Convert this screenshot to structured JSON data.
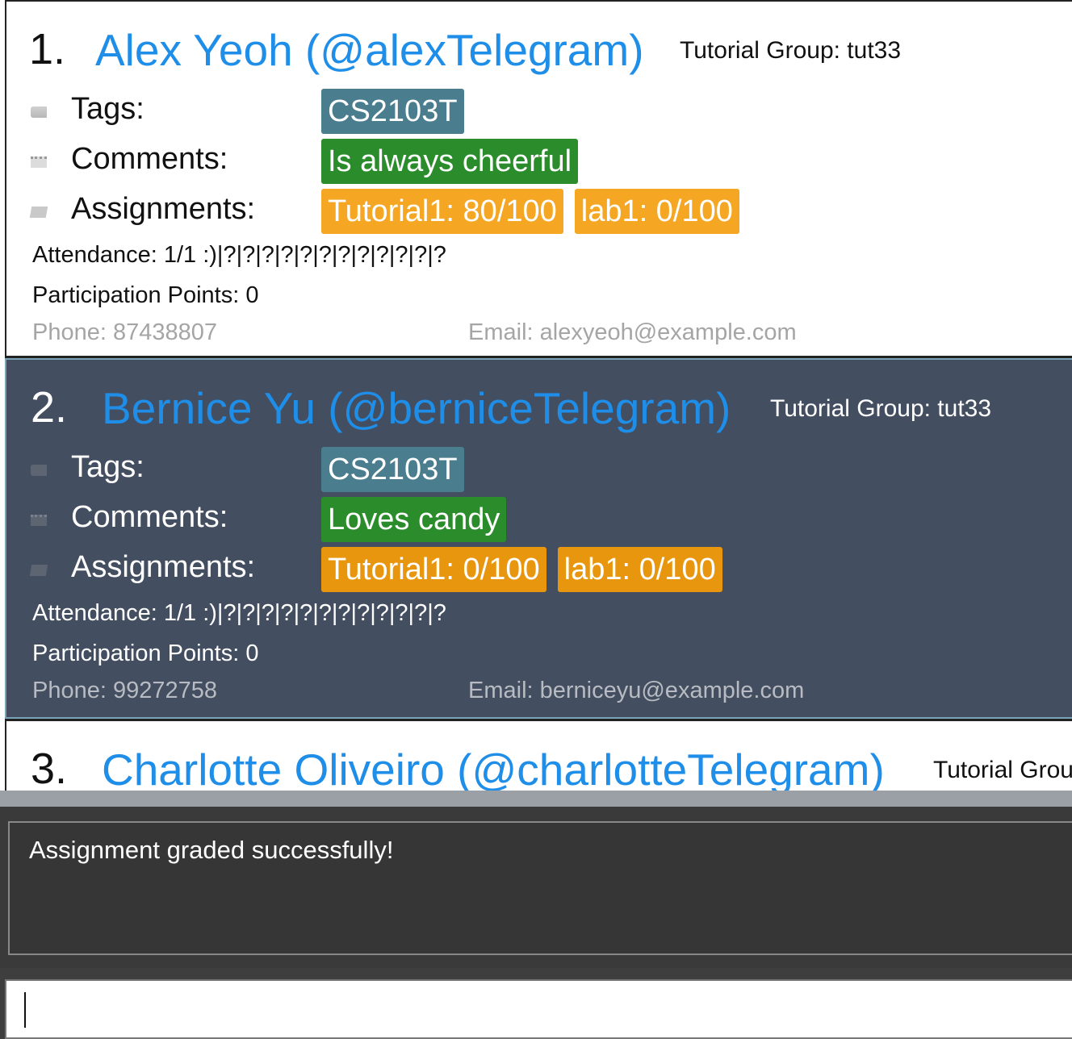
{
  "persons": [
    {
      "index": "1.",
      "name": "Alex Yeoh (@alexTelegram)",
      "tutorial_group": "Tutorial Group: tut33",
      "tags_label": "Tags:",
      "tags": [
        "CS2103T"
      ],
      "comments_label": "Comments:",
      "comments": [
        "Is always cheerful"
      ],
      "assignments_label": "Assignments:",
      "assignments": [
        "Tutorial1: 80/100",
        "lab1: 0/100"
      ],
      "attendance": "Attendance: 1/1  :)|?|?|?|?|?|?|?|?|?|?|?|?",
      "participation": "Participation Points: 0",
      "phone": "Phone: 87438807",
      "email": "Email: alexyeoh@example.com"
    },
    {
      "index": "2.",
      "name": "Bernice Yu (@berniceTelegram)",
      "tutorial_group": "Tutorial Group: tut33",
      "tags_label": "Tags:",
      "tags": [
        "CS2103T"
      ],
      "comments_label": "Comments:",
      "comments": [
        "Loves candy"
      ],
      "assignments_label": "Assignments:",
      "assignments": [
        "Tutorial1: 0/100",
        "lab1: 0/100"
      ],
      "attendance": "Attendance: 1/1  :)|?|?|?|?|?|?|?|?|?|?|?|?",
      "participation": "Participation Points: 0",
      "phone": "Phone: 99272758",
      "email": "Email: berniceyu@example.com"
    },
    {
      "index": "3.",
      "name": "Charlotte Oliveiro (@charlotteTelegram)",
      "tutorial_group": "Tutorial Grou"
    }
  ],
  "result_display": {
    "message": "Assignment graded successfully!"
  },
  "command_box": {
    "value": ""
  },
  "icons": {
    "tag": "tag-icon",
    "comment": "notepad-icon",
    "assignment": "pencil-icon"
  },
  "colors": {
    "name": "#1f8ee8",
    "tag_chip": "#4a7d8e",
    "comment_chip": "#2a8c2a",
    "assignment_chip": "#f5a623",
    "selected_card": "#434e60"
  }
}
